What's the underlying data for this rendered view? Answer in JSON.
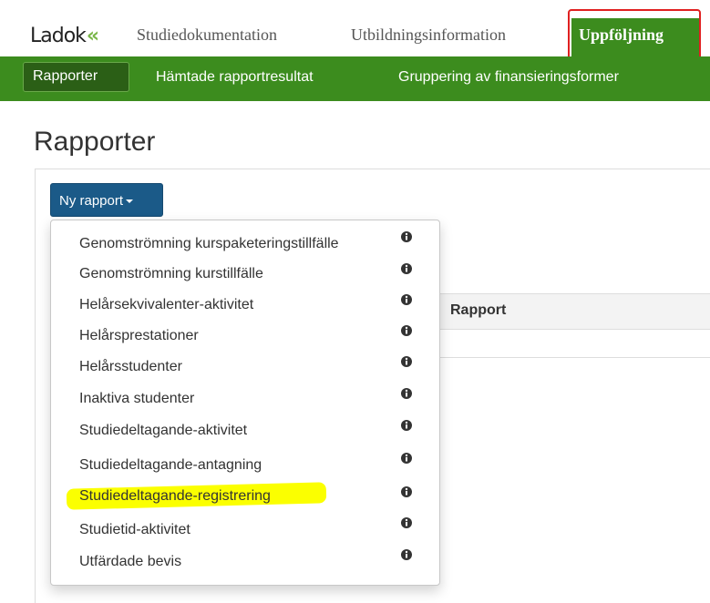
{
  "app": {
    "logo_text": "Ladok",
    "logo_mark": "«"
  },
  "topnav": {
    "items": [
      "Studiedokumentation",
      "Utbildningsinformation"
    ],
    "active_label": "Uppföljning"
  },
  "subnav": {
    "active_label": "Rapporter",
    "items": [
      "Hämtade rapportresultat",
      "Gruppering av finansieringsformer"
    ]
  },
  "page": {
    "title": "Rapporter",
    "new_report_label": "Ny rapport",
    "table_header": "Rapport"
  },
  "dropdown": {
    "items": [
      {
        "label": "Genomströmning kurspaketeringstillfälle",
        "icon": "info-icon"
      },
      {
        "label": "Genomströmning kurstillfälle",
        "icon": "info-icon"
      },
      {
        "label": "Helårsekvivalenter-aktivitet",
        "icon": "info-icon"
      },
      {
        "label": "Helårsprestationer",
        "icon": "info-icon"
      },
      {
        "label": "Helårsstudenter",
        "icon": "info-icon"
      },
      {
        "label": "Inaktiva studenter",
        "icon": "info-icon"
      },
      {
        "label": "Studiedeltagande-aktivitet",
        "icon": "info-icon"
      },
      {
        "label": "Studiedeltagande-antagning",
        "icon": "info-icon"
      },
      {
        "label": "Studiedeltagande-registrering",
        "icon": "info-icon",
        "highlighted": true
      },
      {
        "label": "Studietid-aktivitet",
        "icon": "info-icon"
      },
      {
        "label": "Utfärdade bevis",
        "icon": "info-icon"
      }
    ]
  },
  "colors": {
    "nav_green": "#3c8c1e",
    "button_blue": "#1b5a88",
    "annotation_red": "#e02020",
    "highlight_yellow": "#fbff00"
  }
}
